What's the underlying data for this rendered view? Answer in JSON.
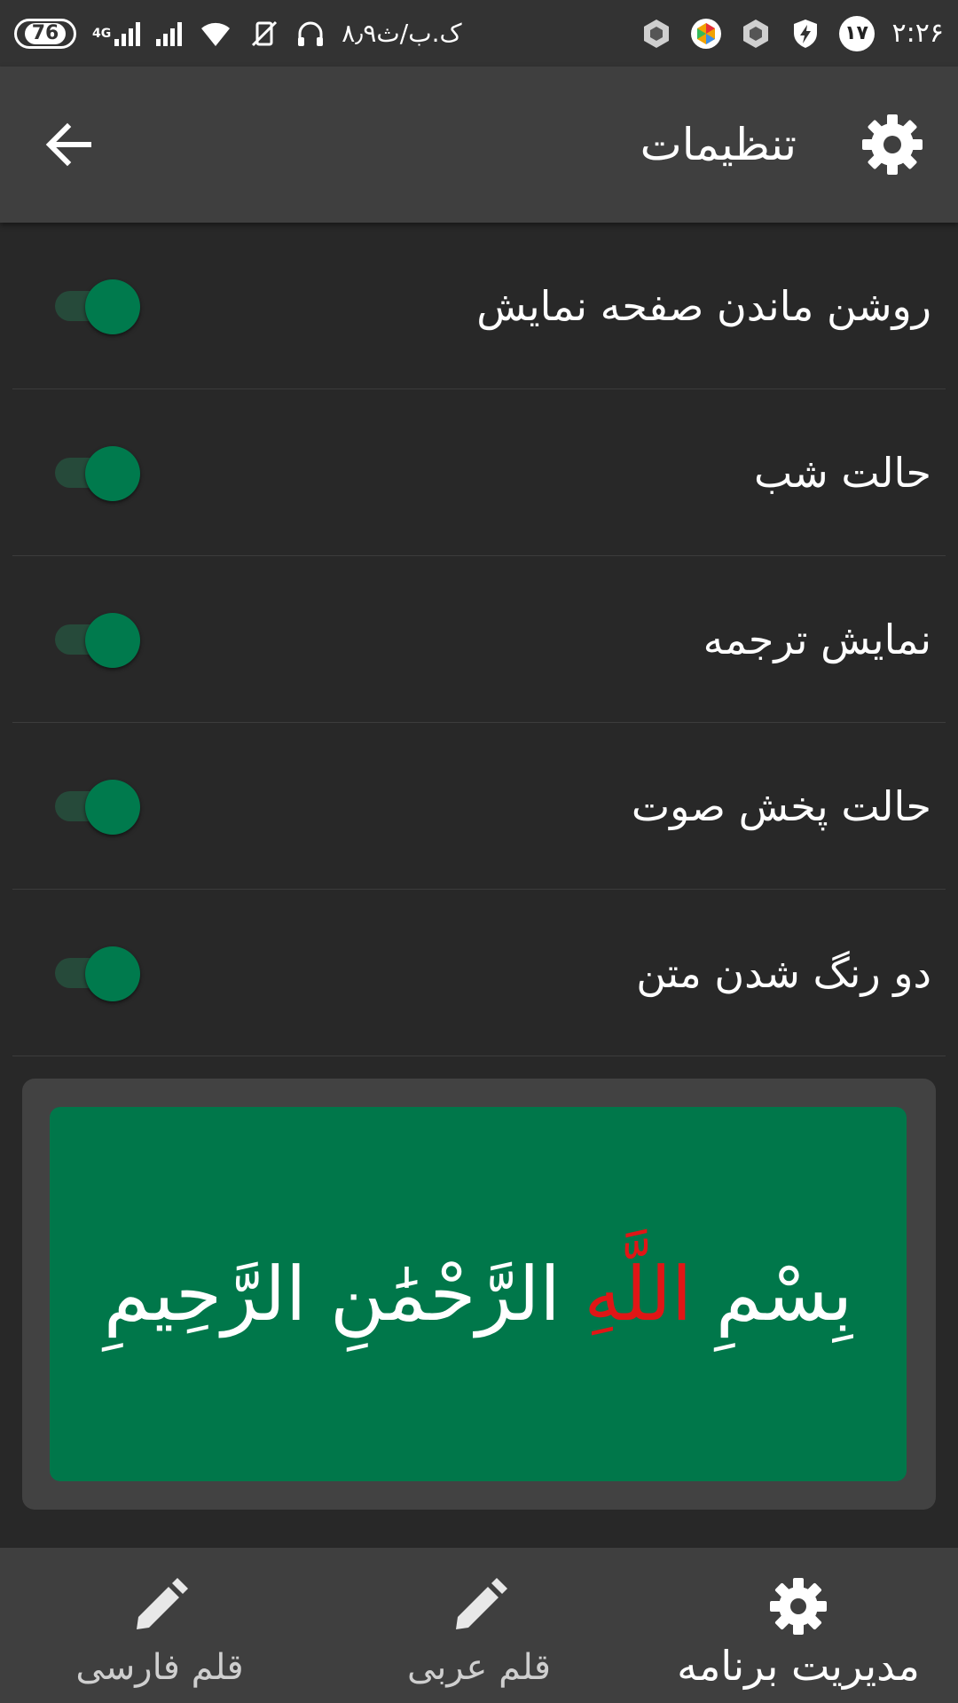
{
  "status_bar": {
    "time": "۲:۲۶",
    "badge_number": "۱۷",
    "carrier_speed": "۸٫۹ک.ب/ث",
    "battery_level": "76",
    "network_type": "4G",
    "icons": [
      "battery-icon",
      "signal-icon",
      "wifi-icon",
      "vibrate-off-icon",
      "headset-icon",
      "hexagon-icon",
      "colorful-app-icon",
      "hexagon-icon",
      "shield-bolt-icon",
      "notification-count-icon"
    ]
  },
  "app_bar": {
    "title": "تنظیمات",
    "back_icon": "arrow-left-icon",
    "settings_icon": "gear-icon"
  },
  "settings": [
    {
      "label": "روشن ماندن صفحه نمایش",
      "enabled": true
    },
    {
      "label": "حالت شب",
      "enabled": true
    },
    {
      "label": "نمایش ترجمه",
      "enabled": true
    },
    {
      "label": "حالت پخش صوت",
      "enabled": true
    },
    {
      "label": "دو رنگ شدن متن",
      "enabled": true
    }
  ],
  "preview": {
    "text_before": "بِسْمِ ",
    "text_highlight": "اللَّهِ",
    "text_after": " الرَّحْمَٰنِ الرَّحِيمِ",
    "background_color": "#00774a",
    "highlight_color": "#e01616"
  },
  "bottom_nav": {
    "items": [
      {
        "label": "قلم فارسی",
        "icon": "pencil-icon",
        "active": false
      },
      {
        "label": "قلم عربی",
        "icon": "pencil-icon",
        "active": false
      },
      {
        "label": "مدیریت برنامه",
        "icon": "gear-icon",
        "active": true
      }
    ]
  },
  "colors": {
    "accent": "#007a4d",
    "toolbar": "#3f3f3f",
    "background": "#282828"
  }
}
